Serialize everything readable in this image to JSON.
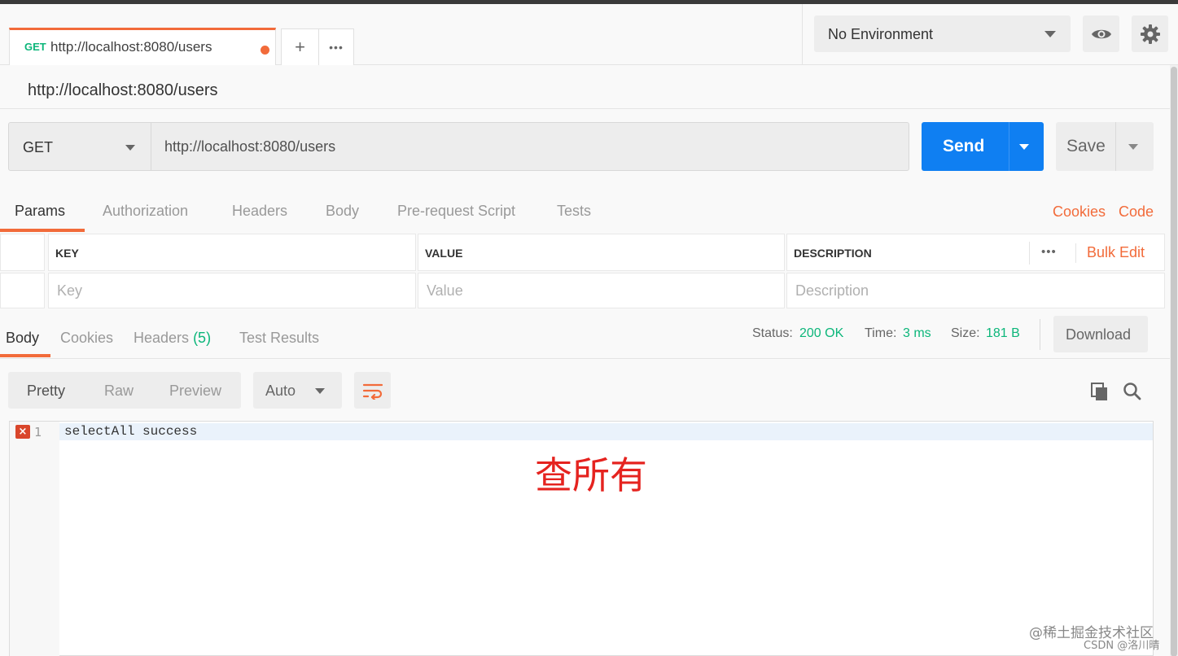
{
  "tab": {
    "method": "GET",
    "url": "http://localhost:8080/users",
    "add_label": "+",
    "more_label": "•••"
  },
  "environment": {
    "selected": "No Environment"
  },
  "request": {
    "title": "http://localhost:8080/users",
    "method": "GET",
    "url": "http://localhost:8080/users",
    "send_label": "Send",
    "save_label": "Save"
  },
  "request_tabs": {
    "items": [
      "Params",
      "Authorization",
      "Headers",
      "Body",
      "Pre-request Script",
      "Tests"
    ],
    "cookies_label": "Cookies",
    "code_label": "Code"
  },
  "params": {
    "headers": {
      "key": "KEY",
      "value": "VALUE",
      "description": "DESCRIPTION"
    },
    "more_label": "•••",
    "bulk_edit_label": "Bulk Edit",
    "placeholders": {
      "key": "Key",
      "value": "Value",
      "description": "Description"
    }
  },
  "response": {
    "tabs": [
      "Body",
      "Cookies",
      "Headers",
      "Test Results"
    ],
    "headers_count": "(5)",
    "status_label": "Status:",
    "status_value": "200 OK",
    "time_label": "Time:",
    "time_value": "3 ms",
    "size_label": "Size:",
    "size_value": "181 B",
    "download_label": "Download",
    "view_modes": [
      "Pretty",
      "Raw",
      "Preview"
    ],
    "format": "Auto",
    "line_number": "1",
    "code_line": "selectAll success"
  },
  "annotation": "查所有",
  "watermark": {
    "line1": "@稀土掘金技术社区",
    "line2": "CSDN @洛川晴"
  },
  "colors": {
    "accent": "#f26b3a",
    "send": "#0f7ff2",
    "success": "#0cb67a",
    "annotation": "#e5231f"
  }
}
